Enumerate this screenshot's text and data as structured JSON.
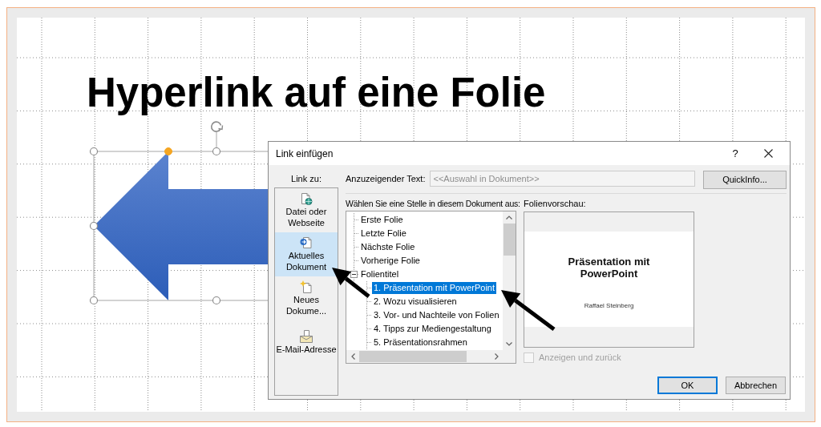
{
  "slide": {
    "title": "Hyperlink auf eine Folie"
  },
  "dialog": {
    "title": "Link einfügen",
    "help_button": "?",
    "link_to": {
      "label": "Link zu:",
      "items": [
        {
          "kind": "file",
          "label": "Datei oder Webseite",
          "selected": false
        },
        {
          "kind": "current",
          "label": "Aktuelles Dokument",
          "selected": true
        },
        {
          "kind": "new",
          "label": "Neues Dokume...",
          "selected": false
        },
        {
          "kind": "email",
          "label": "E-Mail-Adresse",
          "selected": false
        }
      ]
    },
    "display_text": {
      "label": "Anzuzeigender Text:",
      "value": "<<Auswahl in Dokument>>",
      "disabled": true
    },
    "quickinfo_button": "QuickInfo...",
    "place": {
      "label": "Wählen Sie eine Stelle in diesem Dokument aus:",
      "items": [
        {
          "label": "Erste Folie",
          "selected": false
        },
        {
          "label": "Letzte Folie",
          "selected": false
        },
        {
          "label": "Nächste Folie",
          "selected": false
        },
        {
          "label": "Vorherige Folie",
          "selected": false
        },
        {
          "label": "Folientitel",
          "selected": false,
          "expanded": true,
          "children": [
            {
              "label": "1. Präsentation mit PowerPoint",
              "selected": true
            },
            {
              "label": "2. Wozu visualisieren",
              "selected": false
            },
            {
              "label": "3. Vor- und Nachteile von Folien",
              "selected": false
            },
            {
              "label": "4. Tipps zur Mediengestaltung",
              "selected": false
            },
            {
              "label": "5. Präsentationsrahmen",
              "selected": false
            }
          ]
        }
      ]
    },
    "preview": {
      "label": "Folienvorschau:",
      "slide_title": "Präsentation mit PowerPoint",
      "slide_subtitle": "Raffael Steinberg"
    },
    "show_and_return": {
      "label": "Anzeigen und zurück",
      "checked": false,
      "disabled": true
    },
    "buttons": [
      {
        "label": "OK",
        "default": true
      },
      {
        "label": "Abbrechen",
        "default": false
      }
    ]
  }
}
